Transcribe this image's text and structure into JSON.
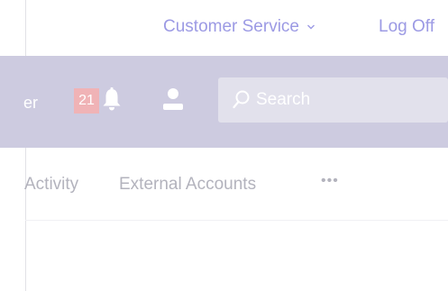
{
  "topbar": {
    "customer_service_label": "Customer Service",
    "logoff_label": "Log Off"
  },
  "navbar": {
    "user_fragment": "er",
    "notification_count": "21",
    "search_placeholder": "Search",
    "background_color": "#cdcbe0"
  },
  "tabs": {
    "items": [
      {
        "label": "Activity"
      },
      {
        "label": "External Accounts"
      },
      {
        "label": "•••"
      }
    ]
  },
  "icons": [
    "chevron-down-icon",
    "bell-icon",
    "user-icon",
    "search-icon"
  ]
}
